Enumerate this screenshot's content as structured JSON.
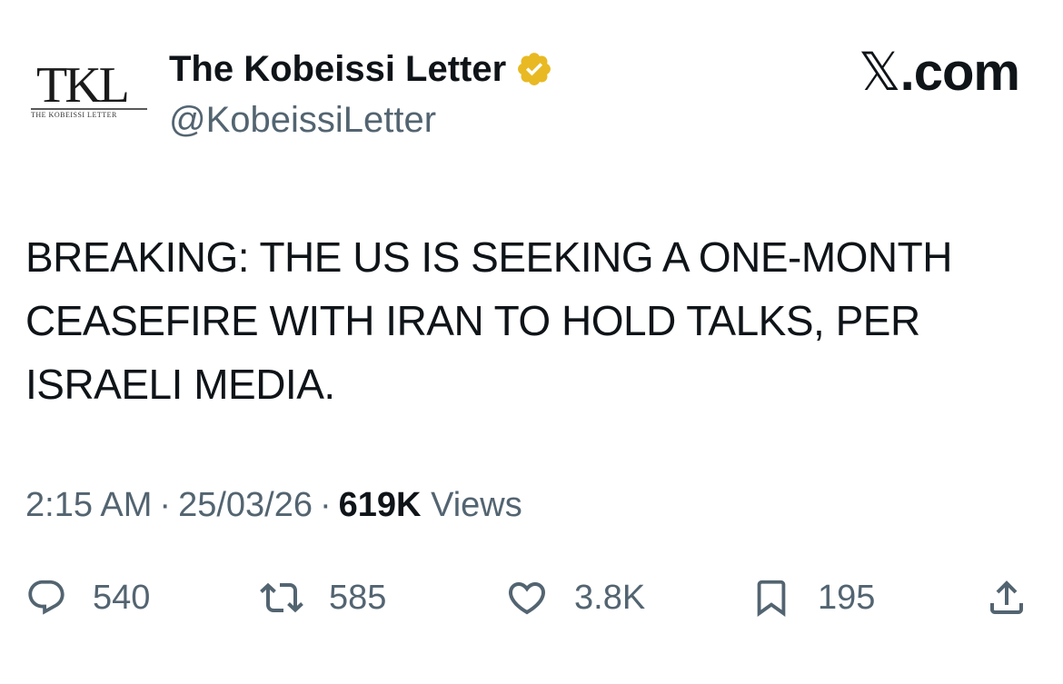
{
  "avatar": {
    "monogram": "TKL",
    "subtitle": "THE KOBEISSI LETTER"
  },
  "author": {
    "display_name": "The Kobeissi Letter",
    "handle": "@KobeissiLetter",
    "verified": true,
    "verified_color": "#E8B923"
  },
  "brand": {
    "x_glyph": "𝕏",
    "domain": ".com"
  },
  "tweet": {
    "lines": [
      "BREAKING: THE US IS SEEKING A ONE-MONTH",
      "CEASEFIRE WITH IRAN TO HOLD TALKS, PER",
      "ISRAELI MEDIA."
    ]
  },
  "meta": {
    "time": "2:15 AM",
    "separator": "·",
    "date": "25/03/26",
    "views_count": "619K",
    "views_label": "Views"
  },
  "actions": {
    "replies": "540",
    "reposts": "585",
    "likes": "3.8K",
    "bookmarks": "195"
  },
  "colors": {
    "text": "#0f1419",
    "secondary": "#536471",
    "icon": "#536471"
  }
}
